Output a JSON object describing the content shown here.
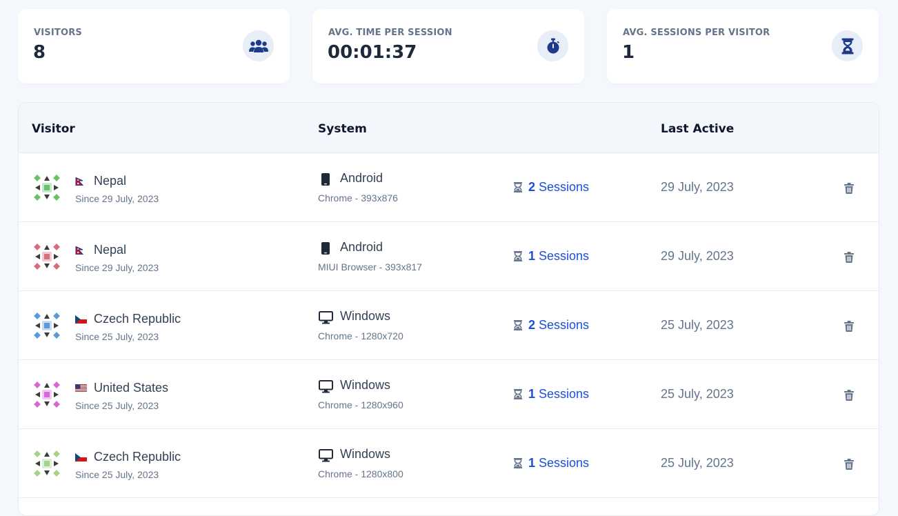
{
  "stats": [
    {
      "label": "VISITORS",
      "value": "8",
      "icon": "users-icon"
    },
    {
      "label": "AVG. TIME PER SESSION",
      "value": "00:01:37",
      "icon": "stopwatch-icon"
    },
    {
      "label": "AVG. SESSIONS PER VISITOR",
      "value": "1",
      "icon": "hourglass-icon"
    }
  ],
  "table": {
    "headers": {
      "visitor": "Visitor",
      "system": "System",
      "last_active": "Last Active"
    },
    "rows": [
      {
        "country": "Nepal",
        "flag": "nepal",
        "since": "Since 29 July, 2023",
        "os": "Android",
        "os_icon": "mobile-icon",
        "browser": "Chrome - 393x876",
        "session_count": "2",
        "session_label": "Sessions",
        "last_active": "29 July, 2023",
        "avatar_color": "#6cc06a"
      },
      {
        "country": "Nepal",
        "flag": "nepal",
        "since": "Since 29 July, 2023",
        "os": "Android",
        "os_icon": "mobile-icon",
        "browser": "MIUI Browser - 393x817",
        "session_count": "1",
        "session_label": "Sessions",
        "last_active": "29 July, 2023",
        "avatar_color": "#d4707a"
      },
      {
        "country": "Czech Republic",
        "flag": "czech",
        "since": "Since 25 July, 2023",
        "os": "Windows",
        "os_icon": "monitor-icon",
        "browser": "Chrome - 1280x720",
        "session_count": "2",
        "session_label": "Sessions",
        "last_active": "25 July, 2023",
        "avatar_color": "#5b9bd5"
      },
      {
        "country": "United States",
        "flag": "usa",
        "since": "Since 25 July, 2023",
        "os": "Windows",
        "os_icon": "monitor-icon",
        "browser": "Chrome - 1280x960",
        "session_count": "1",
        "session_label": "Sessions",
        "last_active": "25 July, 2023",
        "avatar_color": "#d36ad6"
      },
      {
        "country": "Czech Republic",
        "flag": "czech",
        "since": "Since 25 July, 2023",
        "os": "Windows",
        "os_icon": "monitor-icon",
        "browser": "Chrome - 1280x800",
        "session_count": "1",
        "session_label": "Sessions",
        "last_active": "25 July, 2023",
        "avatar_color": "#a6d38a"
      }
    ]
  },
  "colors": {
    "accent": "#1d4ed8",
    "icon_dark": "#1e3a8a",
    "muted": "#64748b"
  }
}
